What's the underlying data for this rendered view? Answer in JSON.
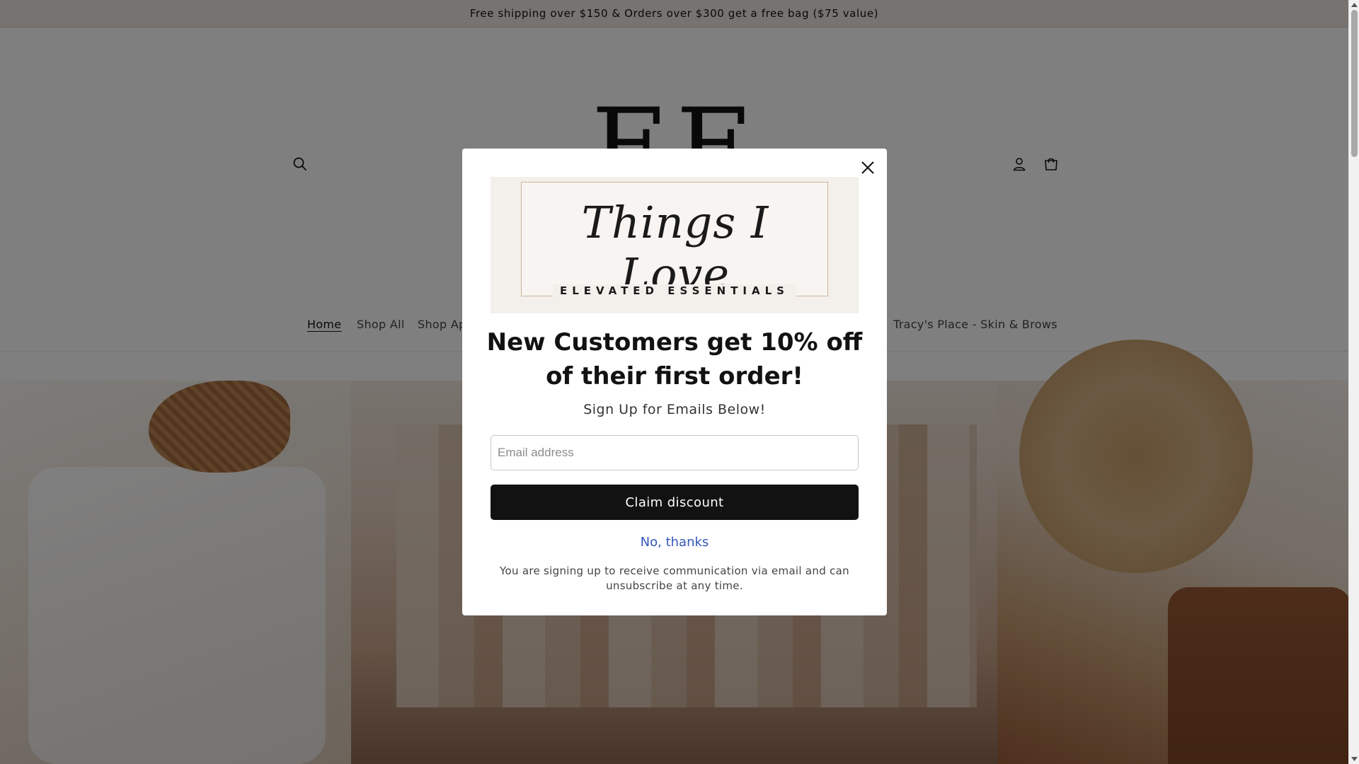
{
  "announcement": {
    "text": "Free shipping over $150 & Orders over $300 get a free bag ($75 value)"
  },
  "header": {
    "logo_text": "EE",
    "icons": {
      "search": "search-icon",
      "account": "account-icon",
      "cart": "cart-icon"
    }
  },
  "nav": {
    "items": [
      {
        "label": "Home",
        "active": true
      },
      {
        "label": "Shop All"
      },
      {
        "label": "Shop Ap"
      },
      {
        "label": "Tracy's Place - Skin & Brows"
      }
    ]
  },
  "popup": {
    "banner_script": "Things I Love",
    "banner_subtitle": "ELEVATED ESSENTIALS",
    "headline": "New Customers get 10% off of their first order!",
    "subheadline": "Sign Up for Emails Below!",
    "email_placeholder": "Email address",
    "email_value": "",
    "claim_label": "Claim discount",
    "decline_label": "No, thanks",
    "disclaimer": "You are signing up to receive communication via email and can unsubscribe at any time.",
    "close_icon": "close-icon"
  },
  "colors": {
    "announcement_bg": "#ece6e2",
    "button_bg": "#121212",
    "link": "#3457b9",
    "overlay": "rgba(0,0,0,0.5)"
  }
}
